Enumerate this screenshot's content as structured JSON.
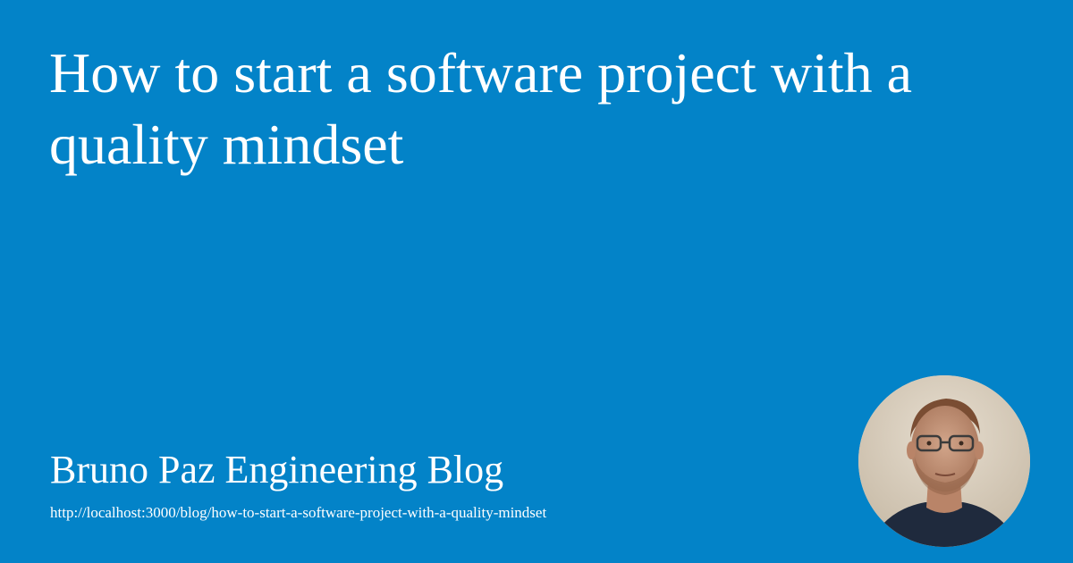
{
  "card": {
    "title": "How to start a software project with a quality mindset",
    "blog_name": "Bruno Paz Engineering Blog",
    "url": "http://localhost:3000/blog/how-to-start-a-software-project-with-a-quality-mindset",
    "avatar_icon": "author-avatar-photo"
  },
  "colors": {
    "background": "#0383c8",
    "text": "#ffffff"
  }
}
